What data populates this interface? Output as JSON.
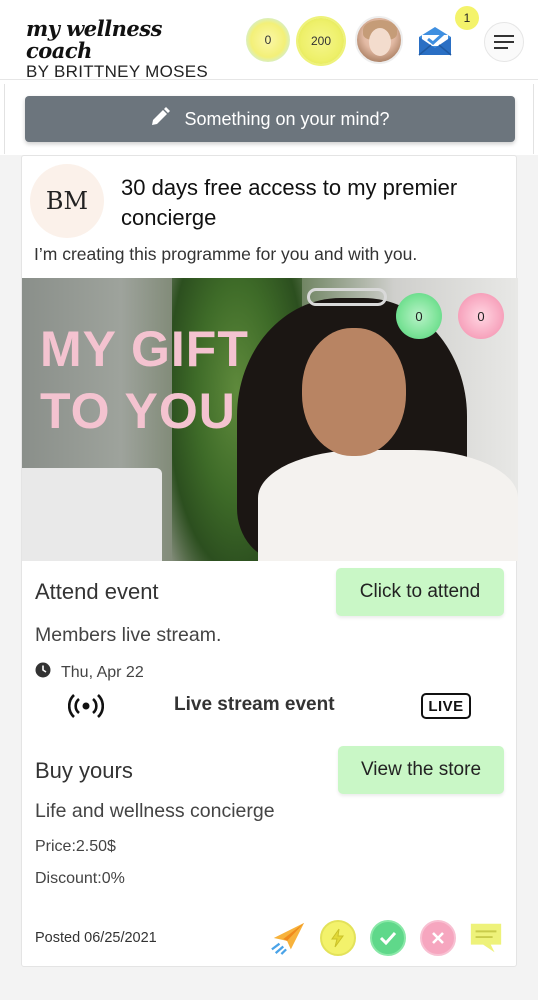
{
  "header": {
    "logo_top": "my wellness coach",
    "logo_bottom": "BY BRITTNEY MOSES",
    "coins": {
      "first": "0",
      "second": "200"
    },
    "notification_count": "1"
  },
  "composer": {
    "placeholder": "Something on your mind?"
  },
  "post": {
    "avatar_initials": "BM",
    "title": "30 days free access to my premier concierge",
    "subtitle": "I’m creating this programme for you and with you.",
    "image_text_line1": "MY GIFT",
    "image_text_line2": "TO YOU",
    "reactions": {
      "green": "0",
      "pink": "0"
    },
    "event": {
      "heading": "Attend event",
      "button": "Click to attend",
      "name": "Members live stream.",
      "date": "Thu, Apr 22",
      "type_label": "Live stream event",
      "live_badge": "LIVE"
    },
    "store": {
      "heading": "Buy yours",
      "button": "View the store",
      "product": "Life and wellness concierge",
      "price": "Price:2.50$",
      "discount": "Discount:0%"
    },
    "posted": "Posted 06/25/2021"
  },
  "colors": {
    "composer_bg": "#6c757d",
    "green_button": "#c9f7c6",
    "coin_yellow": "#eef06a",
    "react_green": "#4fd17a",
    "react_pink": "#f28aa9",
    "gift_text": "#f4c3d0"
  },
  "icons": [
    "pencil-icon",
    "envelope-icon",
    "hamburger-menu-icon",
    "clock-icon",
    "broadcast-icon",
    "paper-plane-icon",
    "lightning-icon",
    "check-icon",
    "close-icon",
    "chat-icon"
  ]
}
